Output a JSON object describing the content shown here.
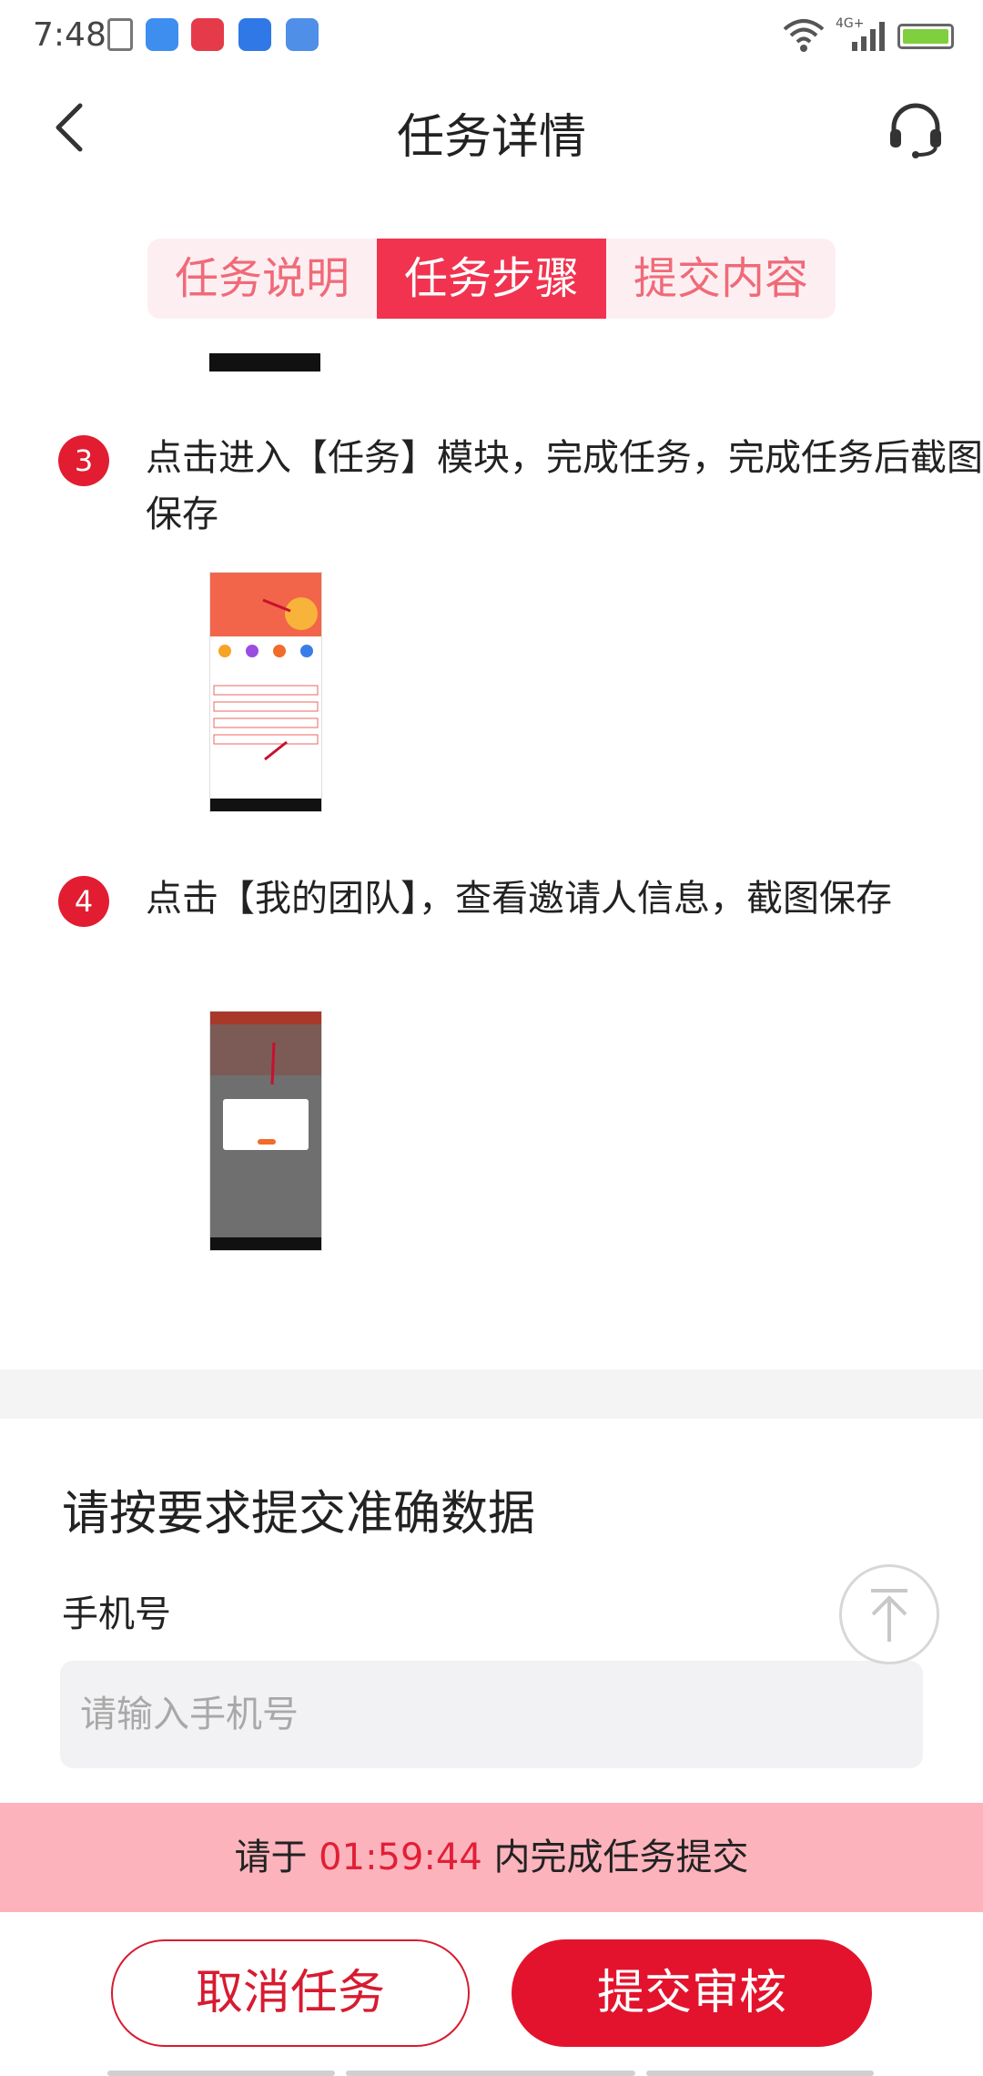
{
  "status_bar": {
    "time": "7:48",
    "network": "4G+"
  },
  "header": {
    "title": "任务详情"
  },
  "tabs": [
    {
      "label": "任务说明"
    },
    {
      "label": "任务步骤"
    },
    {
      "label": "提交内容"
    }
  ],
  "steps": [
    {
      "num": "3",
      "text": "点击进入【任务】模块，完成任务，完成任务后截图保存"
    },
    {
      "num": "4",
      "text": "点击【我的团队】，查看邀请人信息，截图保存"
    }
  ],
  "form": {
    "title": "请按要求提交准确数据",
    "phone_label": "手机号",
    "phone_placeholder": "请输入手机号"
  },
  "countdown": {
    "prefix": "请于",
    "time": "01:59:44",
    "suffix": "内完成任务提交"
  },
  "buttons": {
    "cancel": "取消任务",
    "submit": "提交审核"
  },
  "colors": {
    "accent": "#e3132d",
    "tab_active_bg": "#f1334f",
    "countdown_bg": "#fcb3bc"
  }
}
